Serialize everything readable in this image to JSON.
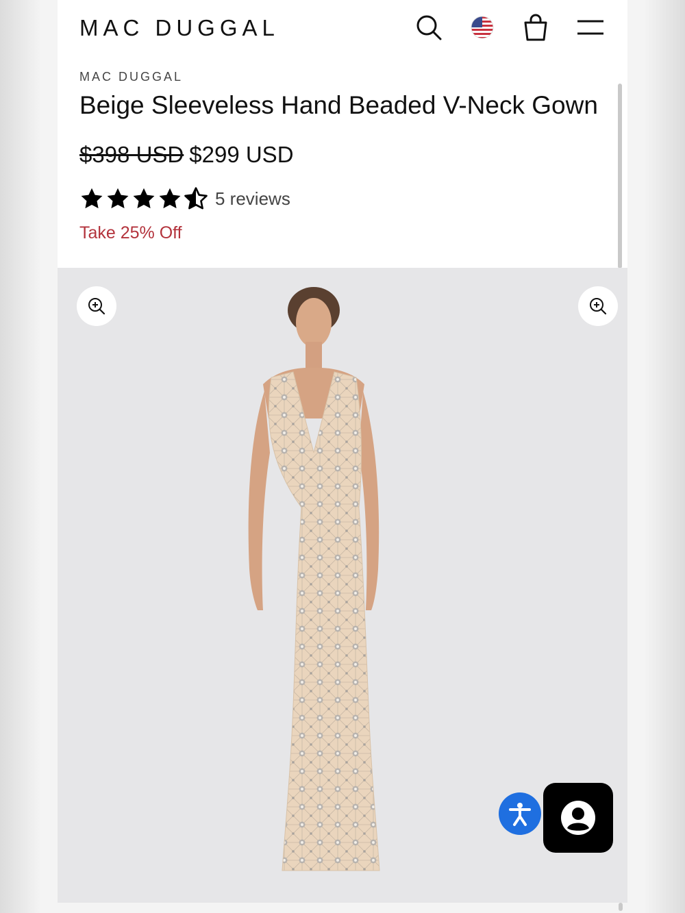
{
  "header": {
    "logo": "MAC DUGGAL",
    "icons": [
      "search-icon",
      "us-flag-icon",
      "shopping-bag-icon",
      "menu-icon"
    ]
  },
  "product": {
    "brand": "MAC DUGGAL",
    "title": "Beige Sleeveless Hand Beaded V-Neck Gown",
    "price_original": "$398 USD",
    "price_sale": "$299 USD",
    "rating_stars": 4.5,
    "reviews_label": "5 reviews",
    "promo": "Take 25% Off"
  },
  "gallery": {
    "icons": [
      "zoom-in-icon",
      "zoom-in-icon"
    ]
  },
  "widgets": {
    "icons": [
      "accessibility-icon",
      "chat-user-icon"
    ]
  },
  "colors": {
    "promo_red": "#b3333c",
    "gallery_bg": "#e6e6e8",
    "a11y_blue": "#1f6fe0",
    "dress": "#e8d3bb"
  }
}
